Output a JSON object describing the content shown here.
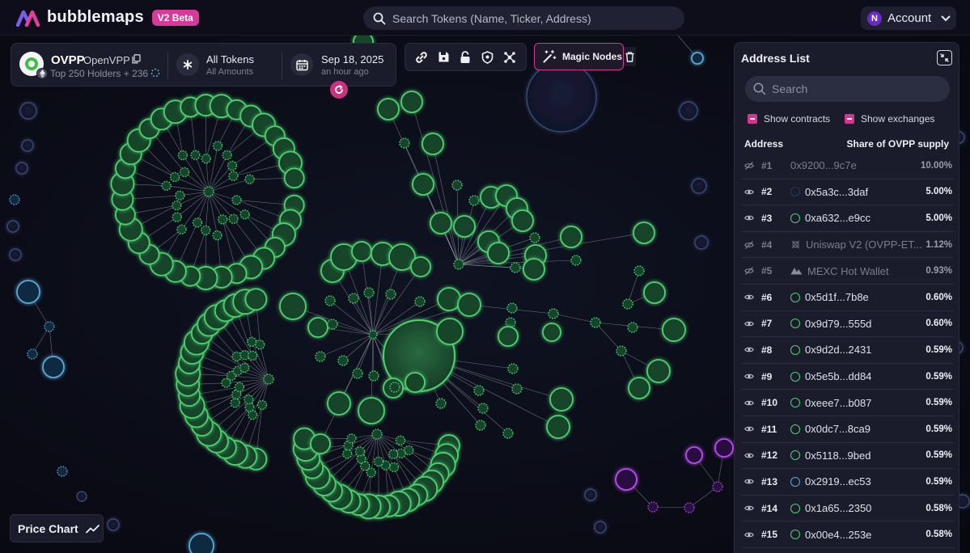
{
  "app": {
    "name": "bubblemaps",
    "badge": "V2 Beta",
    "search_placeholder": "Search Tokens (Name, Ticker, Address)",
    "account_label": "Account",
    "account_initial": "N"
  },
  "token": {
    "symbol": "OVPP",
    "name": "OpenVPP",
    "holders": "Top 250 Holders + 236",
    "filter_main": "All Tokens",
    "filter_sub": "All Amounts",
    "date_main": "Sep 18, 2025",
    "date_sub": "an hour ago"
  },
  "toolbar": {
    "tools": [
      "link-icon",
      "save-icon",
      "lock-icon",
      "shield-icon",
      "network-icon"
    ],
    "magic_label": "Magic Nodes"
  },
  "address_list": {
    "title": "Address List",
    "search_placeholder": "Search",
    "show_contracts": "Show contracts",
    "show_exchanges": "Show exchanges",
    "col_address": "Address",
    "col_share": "Share of OVPP supply",
    "rows": [
      {
        "rank": "#1",
        "address": "0x9200...9c7e",
        "share": "10.00%",
        "hidden": true,
        "dot": "none"
      },
      {
        "rank": "#2",
        "address": "0x5a3c...3daf",
        "share": "5.00%",
        "hidden": false,
        "dot": "#2a3a5c"
      },
      {
        "rank": "#3",
        "address": "0xa632...e9cc",
        "share": "5.00%",
        "hidden": false,
        "dot": "#4fd16f"
      },
      {
        "rank": "#4",
        "address": "Uniswap V2 (OVPP-ET...",
        "share": "1.12%",
        "hidden": true,
        "dot": "uniswap"
      },
      {
        "rank": "#5",
        "address": "MEXC Hot Wallet",
        "share": "0.93%",
        "hidden": true,
        "dot": "mexc"
      },
      {
        "rank": "#6",
        "address": "0x5d1f...7b8e",
        "share": "0.60%",
        "hidden": false,
        "dot": "#4fd16f"
      },
      {
        "rank": "#7",
        "address": "0x9d79...555d",
        "share": "0.60%",
        "hidden": false,
        "dot": "#4fd16f"
      },
      {
        "rank": "#8",
        "address": "0x9d2d...2431",
        "share": "0.59%",
        "hidden": false,
        "dot": "#4fd16f"
      },
      {
        "rank": "#9",
        "address": "0x5e5b...dd84",
        "share": "0.59%",
        "hidden": false,
        "dot": "#4fd16f"
      },
      {
        "rank": "#10",
        "address": "0xeee7...b087",
        "share": "0.59%",
        "hidden": false,
        "dot": "#4fd16f"
      },
      {
        "rank": "#11",
        "address": "0x0dc7...8ca9",
        "share": "0.59%",
        "hidden": false,
        "dot": "#4fd16f"
      },
      {
        "rank": "#12",
        "address": "0x5118...9bed",
        "share": "0.59%",
        "hidden": false,
        "dot": "#4fd16f"
      },
      {
        "rank": "#13",
        "address": "0x2919...ec53",
        "share": "0.59%",
        "hidden": false,
        "dot": "#5aa8d8"
      },
      {
        "rank": "#14",
        "address": "0x1a65...2350",
        "share": "0.58%",
        "hidden": false,
        "dot": "#4fd16f"
      },
      {
        "rank": "#15",
        "address": "0x00e4...253e",
        "share": "0.58%",
        "hidden": false,
        "dot": "#4fd16f"
      }
    ]
  },
  "price_chart_label": "Price Chart",
  "colors": {
    "accent": "#d6358f",
    "green_node": "#4fd16f",
    "blue_node": "#5aa8d8",
    "purple_node": "#b84bf0"
  }
}
